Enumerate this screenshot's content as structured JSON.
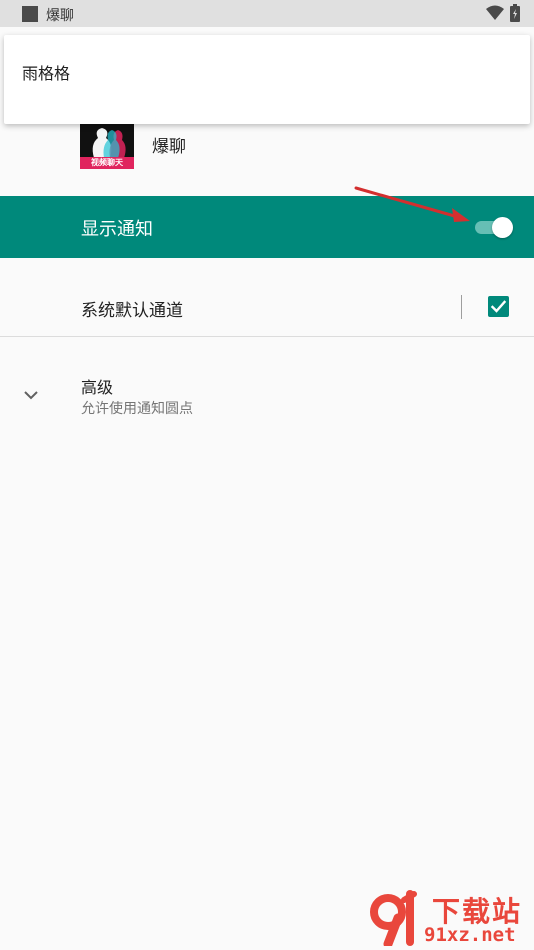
{
  "status_bar": {
    "title": "爆聊",
    "icons": [
      "app-icon",
      "wifi-icon",
      "battery-icon"
    ]
  },
  "popup": {
    "item_label": "雨格格"
  },
  "app": {
    "logo_caption": "视频聊天",
    "name": "爆聊"
  },
  "notify": {
    "label": "显示通知",
    "enabled": true
  },
  "channel": {
    "label": "系统默认通道",
    "checked": true
  },
  "advanced": {
    "title": "高级",
    "subtitle": "允许使用通知圆点"
  },
  "watermark": {
    "title": "下载站",
    "url": "91xz.net"
  },
  "colors": {
    "accent": "#00897b",
    "annotation_arrow": "#d32f2f",
    "watermark": "#e9473c"
  }
}
